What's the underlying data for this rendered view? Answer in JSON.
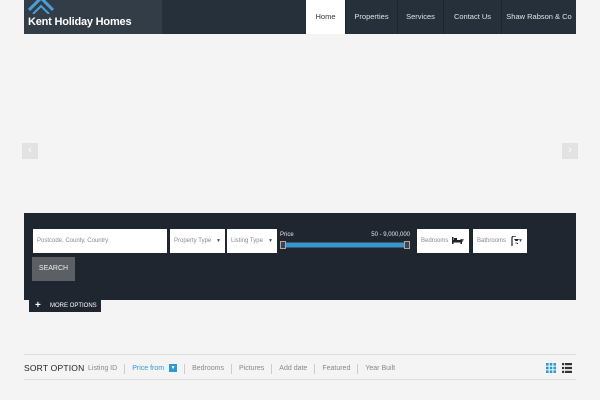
{
  "header": {
    "logo_text": "Kent Holiday Homes",
    "nav": [
      {
        "label": "Home",
        "active": true
      },
      {
        "label": "Properties",
        "active": false
      },
      {
        "label": "Services",
        "active": false
      },
      {
        "label": "Contact Us",
        "active": false
      },
      {
        "label": "Shaw Rabson & Co",
        "active": false
      }
    ]
  },
  "slider": {
    "prev_icon": "chevron-left-icon",
    "next_icon": "chevron-right-icon"
  },
  "search": {
    "location_placeholder": "Postcode, County, Country",
    "property_type": "Property Type",
    "listing_type": "Listing Type",
    "price_label": "Price",
    "price_range": "50 - 9,000,000",
    "bedrooms": "Bedrooms",
    "bathrooms": "Bathrooms",
    "search_label": "SEARCH",
    "more_options": "MORE OPTIONS",
    "accent_color": "#2f99d6"
  },
  "sort": {
    "title": "SORT OPTION",
    "items": [
      {
        "label": "Listing ID",
        "active": false
      },
      {
        "label": "Price from",
        "active": true
      },
      {
        "label": "Bedrooms",
        "active": false
      },
      {
        "label": "Pictures",
        "active": false
      },
      {
        "label": "Add date",
        "active": false
      },
      {
        "label": "Featured",
        "active": false
      },
      {
        "label": "Year Built",
        "active": false
      }
    ],
    "grid_view_icon": "grid-view-icon",
    "list_view_icon": "list-view-icon"
  }
}
